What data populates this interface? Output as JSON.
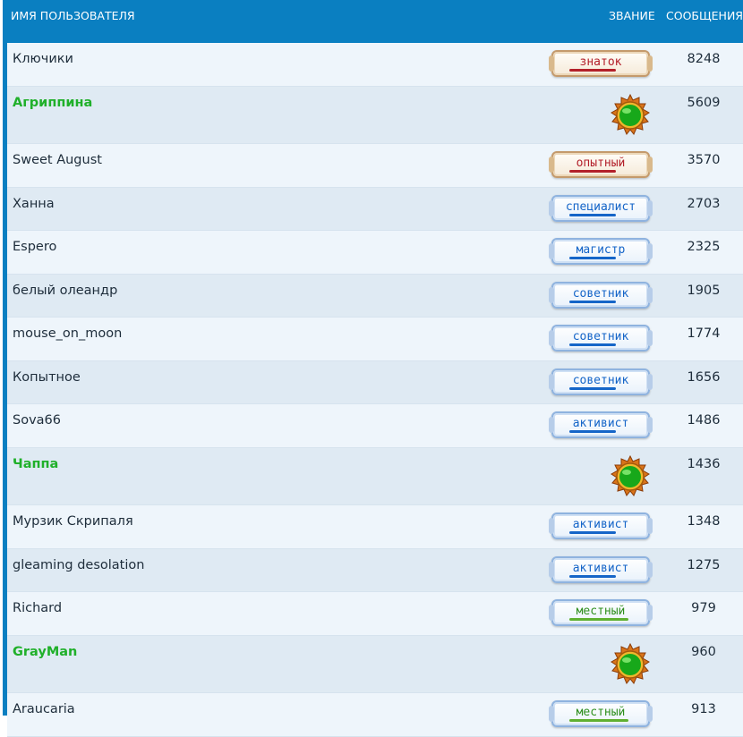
{
  "header": {
    "username": "ИМЯ ПОЛЬЗОВАТЕЛЯ",
    "rank": "ЗВАНИЕ",
    "posts": "СООБЩЕНИЯ"
  },
  "rows": [
    {
      "name": "Ключики",
      "rank": "знаток",
      "posts": "8248"
    },
    {
      "name": "Агриппина",
      "rank_icon": "moderator-medal-icon",
      "posts": "5609"
    },
    {
      "name": "Sweet August",
      "rank": "опытный",
      "posts": "3570"
    },
    {
      "name": "Ханна",
      "rank": "специалист",
      "posts": "2703"
    },
    {
      "name": "Espero",
      "rank": "магистр",
      "posts": "2325"
    },
    {
      "name": "белый олеандр",
      "rank": "советник",
      "posts": "1905"
    },
    {
      "name": "mouse_on_moon",
      "rank": "советник",
      "posts": "1774"
    },
    {
      "name": "Копытное",
      "rank": "советник",
      "posts": "1656"
    },
    {
      "name": "Sova66",
      "rank": "активист",
      "posts": "1486"
    },
    {
      "name": "Чаппа",
      "rank_icon": "moderator-medal-icon",
      "posts": "1436"
    },
    {
      "name": "Мурзик Скрипаля",
      "rank": "активист",
      "posts": "1348"
    },
    {
      "name": "gleaming desolation",
      "rank": "активист",
      "posts": "1275"
    },
    {
      "name": "Richard",
      "rank": "местный",
      "posts": "979"
    },
    {
      "name": "GrayMan",
      "rank_icon": "moderator-medal-icon",
      "posts": "960"
    },
    {
      "name": "Araucaria",
      "rank": "местный",
      "posts": "913"
    }
  ],
  "colors": {
    "header_bg": "#0a7fc1",
    "special_name": "#20b02a",
    "row_odd": "#eef5fb",
    "row_even": "#dfeaf3"
  }
}
